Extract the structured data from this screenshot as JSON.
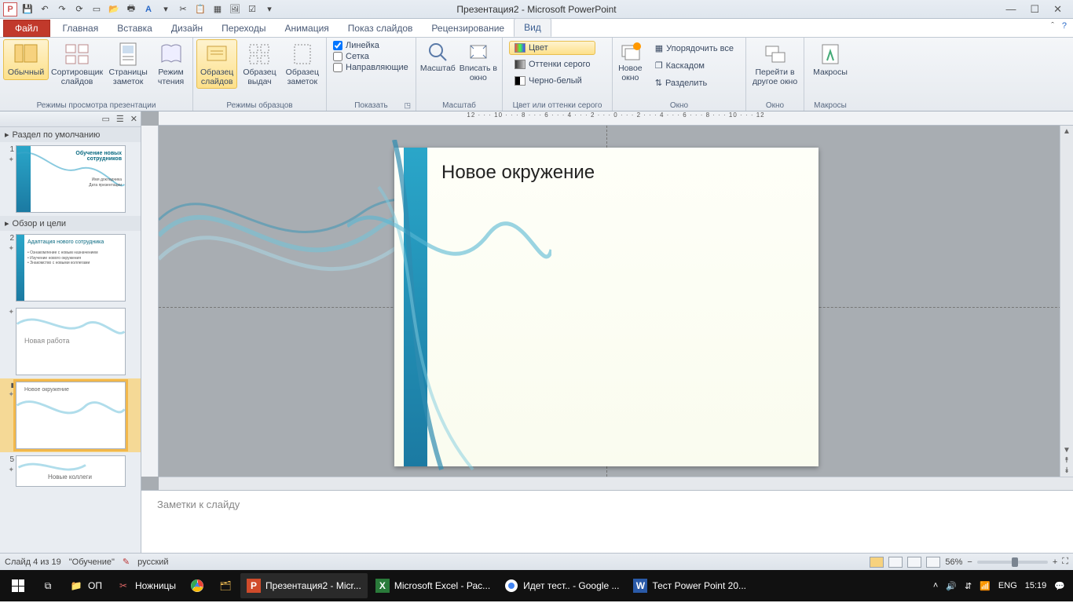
{
  "app": {
    "title": "Презентация2  -  Microsoft PowerPoint",
    "icon_letter": "P"
  },
  "qat_tips": [
    "save",
    "undo",
    "redo",
    "refresh",
    "doc",
    "open",
    "print",
    "spell",
    "font",
    "new",
    "paste",
    "table",
    "pic",
    "chart"
  ],
  "tabs": {
    "file": "Файл",
    "items": [
      "Главная",
      "Вставка",
      "Дизайн",
      "Переходы",
      "Анимация",
      "Показ слайдов",
      "Рецензирование",
      "Вид"
    ],
    "active_index": 7
  },
  "ribbon": {
    "views": {
      "label": "Режимы просмотра презентации",
      "btns": [
        "Обычный",
        "Сортировщик слайдов",
        "Страницы заметок",
        "Режим чтения"
      ],
      "sel": 0
    },
    "masters": {
      "label": "Режимы образцов",
      "btns": [
        "Образец слайдов",
        "Образец выдач",
        "Образец заметок"
      ],
      "sel": 0
    },
    "show": {
      "label": "Показать",
      "items": [
        {
          "label": "Линейка",
          "checked": true
        },
        {
          "label": "Сетка",
          "checked": false
        },
        {
          "label": "Направляющие",
          "checked": false
        }
      ]
    },
    "zoom": {
      "label": "Масштаб",
      "btns": [
        "Масштаб",
        "Вписать в окно"
      ]
    },
    "color": {
      "label": "Цвет или оттенки серого",
      "items": [
        {
          "label": "Цвет",
          "color": "#ff0000",
          "sel": true
        },
        {
          "label": "Оттенки серого",
          "color": "#888888",
          "sel": false
        },
        {
          "label": "Черно-белый",
          "color": "#000000",
          "sel": false
        }
      ]
    },
    "window": {
      "label": "Окно",
      "big": "Новое окно",
      "items": [
        "Упорядочить все",
        "Каскадом",
        "Разделить"
      ]
    },
    "switch": {
      "label": "",
      "btn": "Перейти в другое окно",
      "big_drop": "▾"
    },
    "macros": {
      "label": "Макросы",
      "btn": "Макросы"
    }
  },
  "panel": {
    "sections": [
      {
        "title": "Раздел по умолчанию",
        "slides": [
          {
            "num": "1",
            "title": "Обучение новых сотрудников",
            "lines": [
              "Имя докладчика",
              "Дата презентации"
            ],
            "band": true
          }
        ]
      },
      {
        "title": "Обзор и цели",
        "slides": [
          {
            "num": "2",
            "title": "Адаптация нового сотрудника",
            "lines": [
              "• Ознакомление с новым назначением",
              "• Изучение нового окружения",
              "• Знакомство с новыми коллегами"
            ],
            "band": true
          },
          {
            "num": "",
            "title": "Новая работа",
            "lines": [],
            "band": false,
            "gray": true
          },
          {
            "num": "",
            "title": "Новое окружение",
            "lines": [],
            "band": false,
            "sel": true
          },
          {
            "num": "5",
            "title": "Новые коллеги",
            "lines": [],
            "band": false
          }
        ]
      }
    ]
  },
  "slide": {
    "title": "Новое окружение"
  },
  "ruler_h_text": "12 · · · 10 · · · 8 · · · 6 · · · 4 · · · 2 · · · 0 · · · 2 · · · 4 · · · 6 · · · 8 · · · 10 · · · 12",
  "notes_placeholder": "Заметки к слайду",
  "status": {
    "left1": "Слайд 4 из 19",
    "left2": "\"Обучение\"",
    "lang": "русский",
    "zoom": "56%"
  },
  "taskbar": {
    "items": [
      {
        "icon": "📁",
        "label": "ОП"
      },
      {
        "icon": "✂",
        "label": "Ножницы"
      },
      {
        "icon": "◉",
        "label": ""
      },
      {
        "icon": "🗂",
        "label": ""
      },
      {
        "icon": "P",
        "label": "Презентация2 - Micr...",
        "active": true,
        "bg": "#d04b2b"
      },
      {
        "icon": "X",
        "label": "Microsoft Excel - Рас...",
        "bg": "#2a7a3a"
      },
      {
        "icon": "◉",
        "label": "Идет тест.. - Google ..."
      },
      {
        "icon": "W",
        "label": "Тест  Power Point 20...",
        "bg": "#2a5aa8"
      }
    ],
    "tray": {
      "lang": "ENG",
      "time": "15:19"
    }
  }
}
